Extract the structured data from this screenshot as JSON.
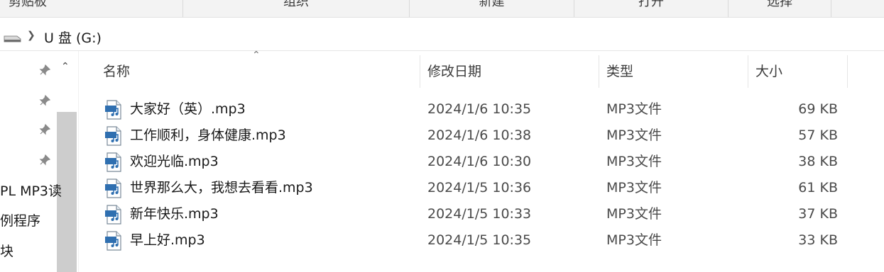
{
  "ribbon": {
    "groups": [
      "剪贴板",
      "组织",
      "新建",
      "打开",
      "选择"
    ]
  },
  "address": {
    "path": "U 盘 (G:)"
  },
  "nav": {
    "items": [
      "PL MP3读",
      "例程序",
      "块"
    ]
  },
  "columns": {
    "name": "名称",
    "date": "修改日期",
    "type": "类型",
    "size": "大小"
  },
  "files": [
    {
      "name": "大家好（英）.mp3",
      "date": "2024/1/6 10:35",
      "type": "MP3文件",
      "size": "69 KB"
    },
    {
      "name": "工作顺利，身体健康.mp3",
      "date": "2024/1/6 10:38",
      "type": "MP3文件",
      "size": "57 KB"
    },
    {
      "name": "欢迎光临.mp3",
      "date": "2024/1/6 10:30",
      "type": "MP3文件",
      "size": "38 KB"
    },
    {
      "name": "世界那么大，我想去看看.mp3",
      "date": "2024/1/5 10:36",
      "type": "MP3文件",
      "size": "61 KB"
    },
    {
      "name": "新年快乐.mp3",
      "date": "2024/1/5 10:33",
      "type": "MP3文件",
      "size": "37 KB"
    },
    {
      "name": "早上好.mp3",
      "date": "2024/1/5 10:35",
      "type": "MP3文件",
      "size": "33 KB"
    }
  ]
}
